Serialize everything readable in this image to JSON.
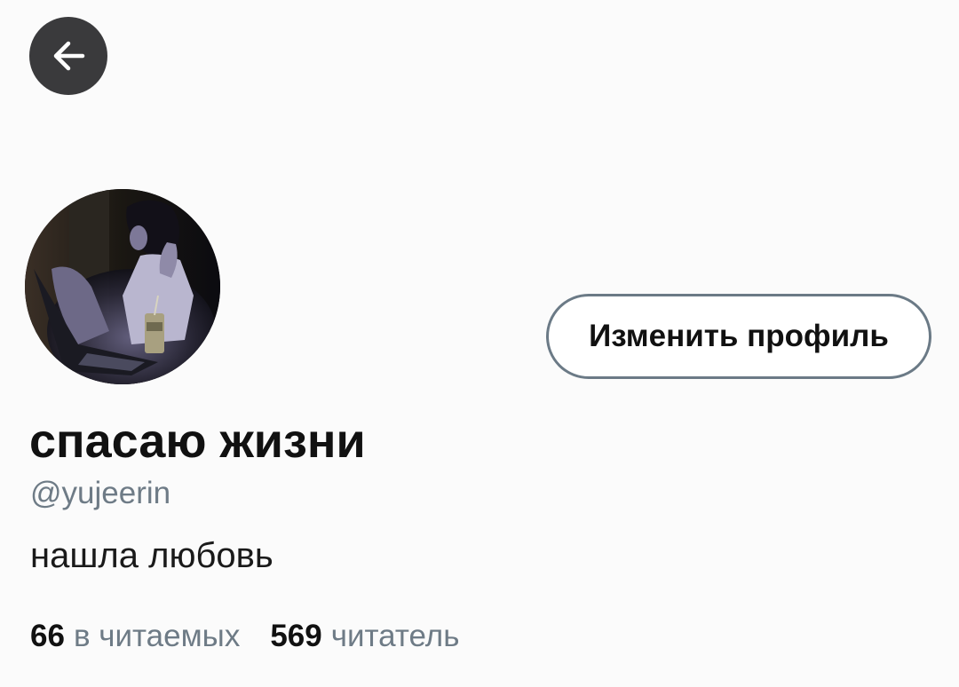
{
  "header": {
    "back_icon": "arrow-left-icon"
  },
  "profile": {
    "avatar_description": "profile photo",
    "edit_button_label": "Изменить профиль",
    "display_name": "спасаю жизни",
    "handle": "@yujeerin",
    "bio": "нашла любовь"
  },
  "stats": {
    "following_count": "66",
    "following_label": "в читаемых",
    "followers_count": "569",
    "followers_label": "читатель"
  },
  "colors": {
    "background": "#fbfbfb",
    "back_button": "#3a3a3c",
    "secondary_text": "#6e7b86",
    "button_border": "#6b7a86"
  }
}
